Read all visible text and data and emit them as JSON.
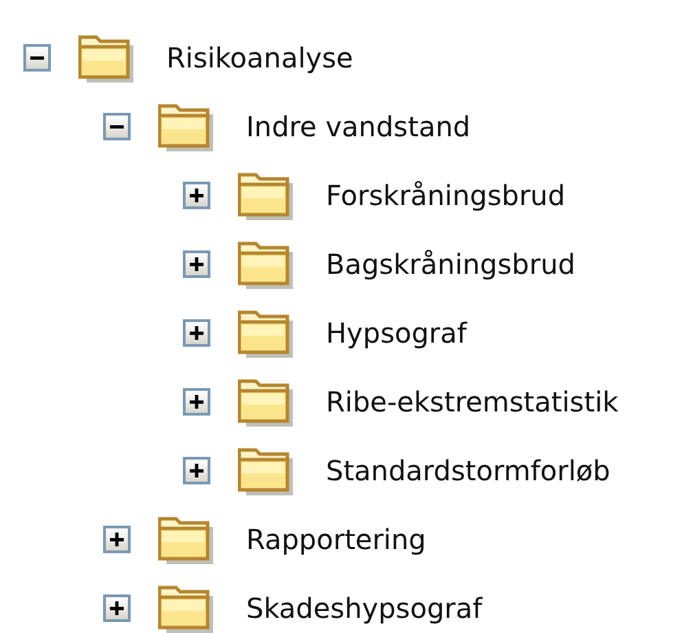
{
  "tree": [
    {
      "label": "Risikoanalyse",
      "expanded": true,
      "children": [
        {
          "label": "Indre vandstand",
          "expanded": true,
          "children": [
            {
              "label": "Forskråningsbrud",
              "expanded": false
            },
            {
              "label": "Bagskråningsbrud",
              "expanded": false
            },
            {
              "label": "Hypsograf",
              "expanded": false
            },
            {
              "label": "Ribe-ekstremstatistik",
              "expanded": false
            },
            {
              "label": "Standardstormforløb",
              "expanded": false
            }
          ]
        },
        {
          "label": "Rapportering",
          "expanded": false
        },
        {
          "label": "Skadeshypsograf",
          "expanded": false
        }
      ]
    }
  ]
}
